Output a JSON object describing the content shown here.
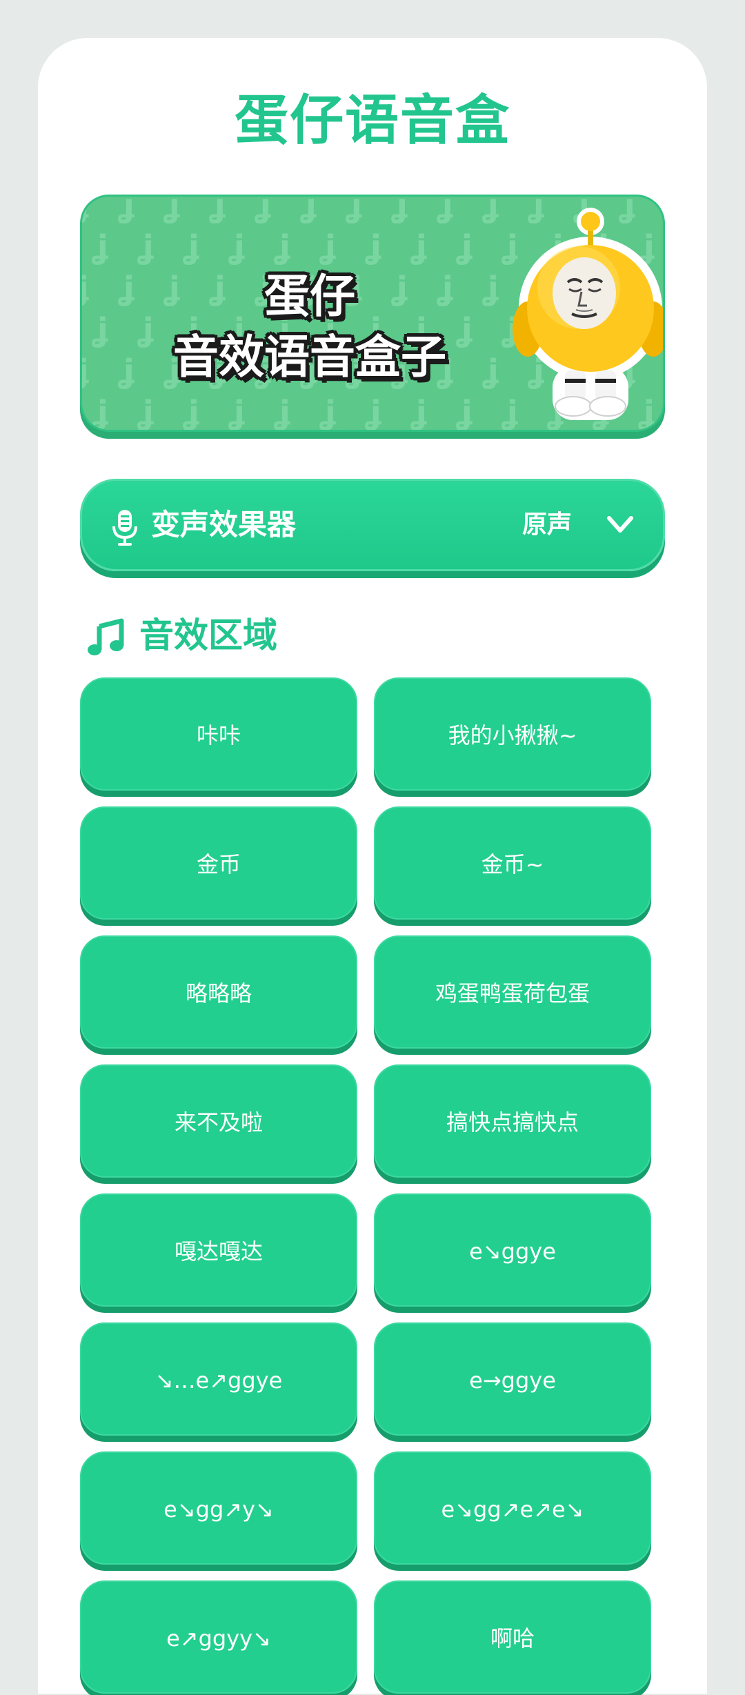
{
  "app": {
    "title": "蛋仔语音盒"
  },
  "banner": {
    "line1": "蛋仔",
    "line2": "音效语音盒子"
  },
  "voice_changer": {
    "label": "变声效果器",
    "value": "原声",
    "icon": "microphone-icon",
    "dropdown_icon": "chevron-down-icon"
  },
  "sound_section": {
    "title": "音效区域",
    "icon": "music-note-icon"
  },
  "sounds": [
    "咔咔",
    "我的小揪揪~",
    "金币",
    "金币~",
    "略略略",
    "鸡蛋鸭蛋荷包蛋",
    "来不及啦",
    "搞快点搞快点",
    "嘎达嘎达",
    "e↘ggye",
    "↘…e↗ggye",
    "e→ggye",
    "e↘gg↗y↘",
    "e↘gg↗e↗e↘",
    "e↗ggyy↘",
    "啊哈"
  ],
  "colors": {
    "accent": "#22c58e",
    "button": "#22cf8f",
    "button_shadow": "#169d6c",
    "background": "#e6ebea",
    "card": "#ffffff"
  }
}
